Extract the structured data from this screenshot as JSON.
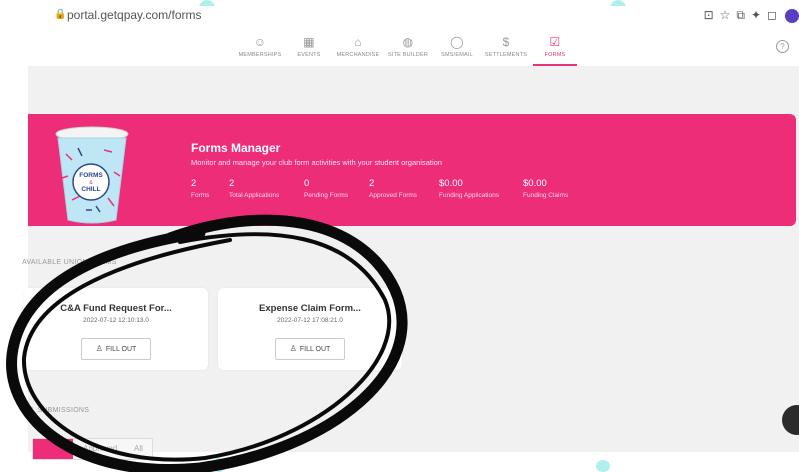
{
  "browser": {
    "url": "portal.getqpay.com/forms"
  },
  "nav": {
    "items": [
      {
        "label": "MEMBERSHIPS",
        "icon": "users-icon",
        "glyph": "☺",
        "active": false
      },
      {
        "label": "EVENTS",
        "icon": "film-icon",
        "glyph": "▦",
        "active": false
      },
      {
        "label": "MERCHANDISE",
        "icon": "store-icon",
        "glyph": "⌂",
        "active": false
      },
      {
        "label": "SITE BUILDER",
        "icon": "globe-icon",
        "glyph": "◍",
        "active": false
      },
      {
        "label": "SMS/EMAIL",
        "icon": "chat-icon",
        "glyph": "◯",
        "active": false
      },
      {
        "label": "SETTLEMENTS",
        "icon": "dollar-icon",
        "glyph": "$",
        "active": false
      },
      {
        "label": "FORMS",
        "icon": "checkbox-icon",
        "glyph": "☑",
        "active": true
      }
    ],
    "help_glyph": "?"
  },
  "banner": {
    "title": "Forms Manager",
    "subtitle": "Monitor and manage your club form activities with your student organisation",
    "stats": [
      {
        "value": "2",
        "label": "Forms"
      },
      {
        "value": "2",
        "label": "Total Applications"
      },
      {
        "value": "0",
        "label": "Pending Forms"
      },
      {
        "value": "2",
        "label": "Approved Forms"
      },
      {
        "value": "$0.00",
        "label": "Funding Applications"
      },
      {
        "value": "$0.00",
        "label": "Funding Claims"
      }
    ],
    "cup_text_top": "FORMS",
    "cup_text_mid": "&",
    "cup_text_bottom": "CHILL",
    "color": "#ee2d78"
  },
  "sections": {
    "available_label": "AVAILABLE UNION FORMS",
    "submissions_label": "ALL SUBMISSIONS"
  },
  "forms": [
    {
      "title": "C&A Fund Request For...",
      "date": "2022-07-12 12:10:13.0",
      "button": "FILL OUT"
    },
    {
      "title": "Expense Claim Form...",
      "date": "2022-07-12 17:08:21.0",
      "button": "FILL OUT"
    }
  ],
  "submission_tabs": [
    "",
    "Approved",
    "All"
  ]
}
